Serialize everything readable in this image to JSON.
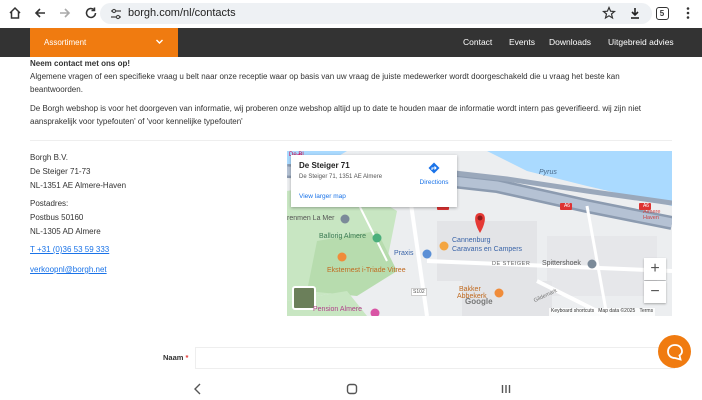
{
  "browser": {
    "url": "borgh.com/nl/contacts",
    "tab_count": "5",
    "icons": [
      "home-icon",
      "back-icon",
      "forward-icon",
      "reload-icon",
      "site-settings-icon",
      "bookmark-star-icon",
      "download-icon",
      "tabs-icon",
      "menu-icon"
    ]
  },
  "nav": {
    "assortment": "Assortiment",
    "links": [
      "Contact",
      "Events",
      "Downloads",
      "Uitgebreid advies"
    ]
  },
  "intro": {
    "heading": "Neem contact met ons op!",
    "paragraph1": "Algemene vragen of een specifieke vraag u belt naar onze receptie waar op basis van uw vraag de juiste medewerker wordt doorgeschakeld die u vraag het beste kan beantwoorden.",
    "paragraph2": "De Borgh webshop is voor het doorgeven van informatie, wij proberen onze webshop altijd up to date te houden maar de informatie wordt intern pas geverifieerd. wij zijn niet aansprakelijk voor typefouten' of 'voor kennelijke typefouten'"
  },
  "address": {
    "company": "Borgh B.V.",
    "street": "De Steiger 71-73",
    "city": "NL-1351 AE Almere-Haven",
    "postal_label": "Postadres:",
    "postbus": "Postbus 50160",
    "postal_city": "NL-1305 AD Almere",
    "phone": "T +31 (0)36 53 59 333",
    "email": "verkoopnl@borgh.net"
  },
  "map": {
    "place_title": "De Steiger 71",
    "place_address": "De Steiger 71, 1351 AE Almere",
    "directions": "Directions",
    "larger_map": "View larger map",
    "labels": {
      "pyrus": "Pyrus",
      "a6_1": "A6",
      "a6_2": "A6",
      "a6_3": "A6",
      "almere_haven": "Almere Haven",
      "la_mer": "renmen La Mer",
      "ballorig": "Ballorig Almere",
      "praxis": "Praxis",
      "cannenburg": "Cannenburg",
      "caravans": "Caravans en Campers",
      "de_steiger": "DE STEIGER",
      "spittershoek": "Spittershoek",
      "eksternest": "Eksternest i-Triade Vitree",
      "abbekerk": "Abbekerk",
      "bakker": "Bakker",
      "pension": "Pension Almere",
      "gildemark": "Gildemark",
      "s102": "S102",
      "google": "Google",
      "keyboard": "Keyboard shortcuts",
      "mapdata": "Map data ©2025",
      "terms": "Terms",
      "top_left": "De Bl"
    },
    "zoom_in": "+",
    "zoom_out": "−"
  },
  "form": {
    "name_label": "Naam",
    "required_mark": "*"
  },
  "colors": {
    "brand_orange": "#f07b10",
    "nav_dark": "#333333",
    "link_blue": "#1a73e8",
    "map_pin": "#e53935"
  }
}
